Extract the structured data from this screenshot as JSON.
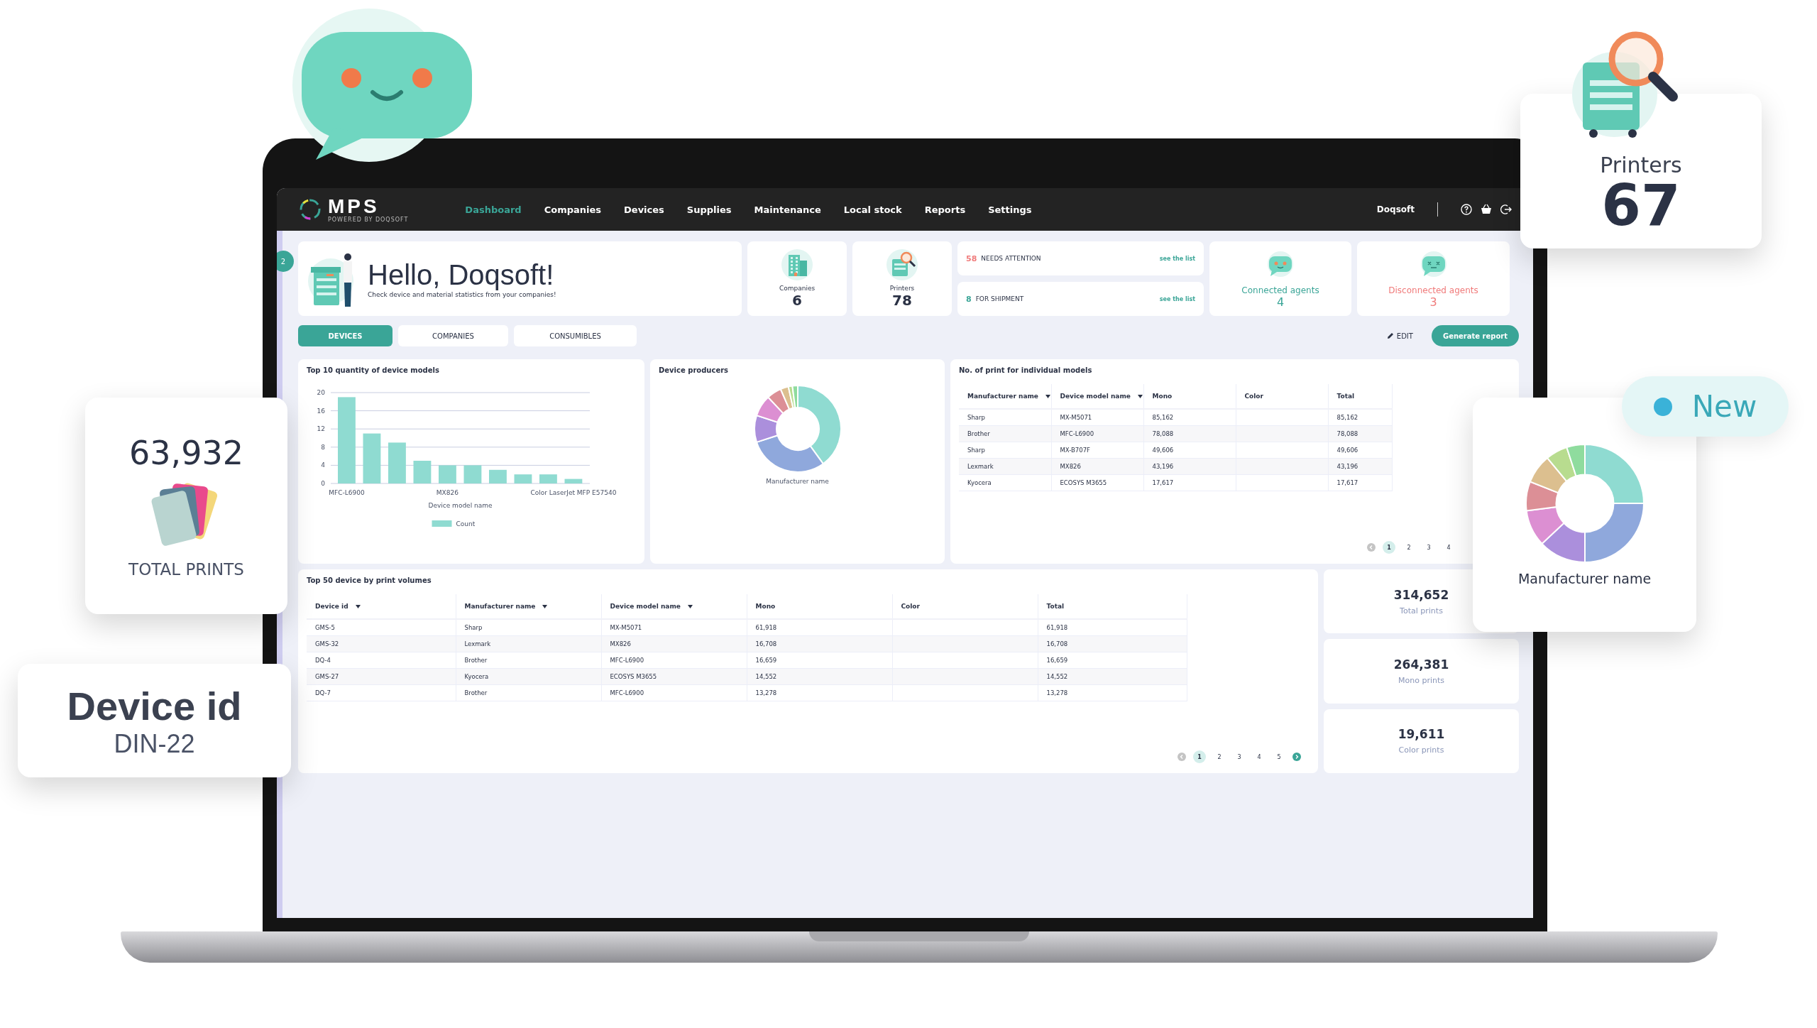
{
  "floating": {
    "printers_card": {
      "label": "Printers",
      "value": "67"
    },
    "total_prints_card": {
      "value": "63,932",
      "label": "TOTAL PRINTS"
    },
    "device_id_card": {
      "label": "Device id",
      "value": "DIN-22"
    },
    "new_badge": {
      "label": "New"
    },
    "donut_card": {
      "label": "Manufacturer name"
    }
  },
  "nav": {
    "logo": "MPS",
    "logo_sub": "POWERED BY DOQSOFT",
    "items": [
      {
        "label": "Dashboard",
        "selected": true
      },
      {
        "label": "Companies",
        "selected": false
      },
      {
        "label": "Devices",
        "selected": false
      },
      {
        "label": "Supplies",
        "selected": false
      },
      {
        "label": "Maintenance",
        "selected": false
      },
      {
        "label": "Local stock",
        "selected": false
      },
      {
        "label": "Reports",
        "selected": false
      },
      {
        "label": "Settings",
        "selected": false
      }
    ],
    "user": "Doqsoft"
  },
  "sidebar_badge": "2",
  "greeting": {
    "title": "Hello, Doqsoft!",
    "subtitle": "Check device and material statistics from your companies!"
  },
  "stats": [
    {
      "kind": "companies",
      "label": "Companies",
      "value": "6"
    },
    {
      "kind": "printers",
      "label": "Printers",
      "value": "78"
    }
  ],
  "alerts": [
    {
      "count": "58",
      "label": "NEEDS ATTENTION",
      "link": "see the list",
      "color": "#f07a7a"
    },
    {
      "count": "8",
      "label": "FOR SHIPMENT",
      "link": "see the list",
      "color": "#3aa597"
    }
  ],
  "agents": [
    {
      "kind": "connected",
      "label": "Connected agents",
      "value": "4"
    },
    {
      "kind": "disconnected",
      "label": "Disconnected agents",
      "value": "3"
    }
  ],
  "tabs": [
    {
      "label": "DEVICES",
      "selected": true
    },
    {
      "label": "COMPANIES",
      "selected": false
    },
    {
      "label": "CONSUMIBLES",
      "selected": false
    }
  ],
  "actions": {
    "edit": "EDIT",
    "report": "Generate report"
  },
  "bar_card": {
    "title": "Top 10 quantity of device models",
    "chart_data": {
      "type": "bar",
      "xlabel": "Device model name",
      "categories": [
        "MFC-L6900",
        null,
        null,
        null,
        "MX826",
        null,
        null,
        null,
        null,
        "Color LaserJet MFP E57540"
      ],
      "series": [
        {
          "name": "Count",
          "color": "#8fdbd1",
          "values": [
            19,
            11,
            9,
            5,
            4,
            4,
            3,
            2,
            2,
            1
          ]
        }
      ],
      "ylim": [
        0,
        20
      ],
      "yticks": [
        0,
        4,
        8,
        12,
        16,
        20
      ],
      "grid": true
    }
  },
  "donut_card": {
    "title": "Device producers",
    "label": "Manufacturer name"
  },
  "models_table": {
    "title": "No. of print for individual models",
    "columns": [
      {
        "label": "Manufacturer name",
        "sortable": true
      },
      {
        "label": "Device model name",
        "sortable": true
      },
      {
        "label": "Mono",
        "sortable": false
      },
      {
        "label": "Color",
        "sortable": false
      },
      {
        "label": "Total",
        "sortable": false
      }
    ],
    "rows": [
      [
        "Sharp",
        "MX-M5071",
        "85,162",
        "",
        "85,162"
      ],
      [
        "Brother",
        "MFC-L6900",
        "78,088",
        "",
        "78,088"
      ],
      [
        "Sharp",
        "MX-B707F",
        "49,606",
        "",
        "49,606"
      ],
      [
        "Lexmark",
        "MX826",
        "43,196",
        "",
        "43,196"
      ],
      [
        "Kyocera",
        "ECOSYS M3655",
        "17,617",
        "",
        "17,617"
      ]
    ],
    "pagination": {
      "pages": [
        {
          "label": "1",
          "selected": true
        },
        {
          "label": "2",
          "selected": false
        },
        {
          "label": "3",
          "selected": false
        },
        {
          "label": "4",
          "selected": false
        }
      ]
    }
  },
  "devices_table": {
    "title": "Top 50 device by print volumes",
    "columns": [
      {
        "label": "Device id",
        "sortable": true
      },
      {
        "label": "Manufacturer name",
        "sortable": true
      },
      {
        "label": "Device model name",
        "sortable": true
      },
      {
        "label": "Mono",
        "sortable": false
      },
      {
        "label": "Color",
        "sortable": false
      },
      {
        "label": "Total",
        "sortable": false
      }
    ],
    "rows": [
      [
        "GMS-5",
        "Sharp",
        "MX-M5071",
        "61,918",
        "",
        "61,918"
      ],
      [
        "GMS-32",
        "Lexmark",
        "MX826",
        "16,708",
        "",
        "16,708"
      ],
      [
        "DQ-4",
        "Brother",
        "MFC-L6900",
        "16,659",
        "",
        "16,659"
      ],
      [
        "GMS-27",
        "Kyocera",
        "ECOSYS M3655",
        "14,552",
        "",
        "14,552"
      ],
      [
        "DQ-7",
        "Brother",
        "MFC-L6900",
        "13,278",
        "",
        "13,278"
      ]
    ],
    "pagination": {
      "pages": [
        {
          "label": "1",
          "selected": true
        },
        {
          "label": "2",
          "selected": false
        },
        {
          "label": "3",
          "selected": false
        },
        {
          "label": "4",
          "selected": false
        },
        {
          "label": "5",
          "selected": false
        }
      ],
      "next_button": true
    }
  },
  "totals": [
    {
      "value": "314,652",
      "label": "Total prints"
    },
    {
      "value": "264,381",
      "label": "Mono prints"
    },
    {
      "value": "19,611",
      "label": "Color prints"
    }
  ]
}
